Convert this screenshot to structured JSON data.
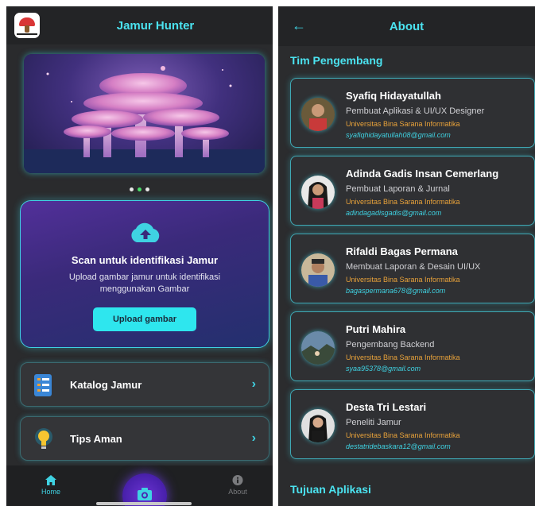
{
  "home": {
    "app_title": "Jamur Hunter",
    "logo_icon": "mushroom-logo-icon",
    "banner": {
      "image": "glowing-mushroom-illustration",
      "dots": 3,
      "active_dot": 2
    },
    "scan_card": {
      "icon": "cloud-upload-icon",
      "title": "Scan untuk identifikasi Jamur",
      "description": "Upload gambar jamur untuk identifikasi menggunakan Gambar",
      "button_label": "Upload gambar"
    },
    "menu": [
      {
        "label": "Katalog Jamur",
        "icon": "catalog-icon"
      },
      {
        "label": "Tips Aman",
        "icon": "lightbulb-icon"
      }
    ],
    "bottom_nav": {
      "home_label": "Home",
      "about_label": "About",
      "camera_icon": "camera-icon"
    }
  },
  "about": {
    "title": "About",
    "back_icon": "arrow-left-icon",
    "team_title": "Tim Pengembang",
    "purpose_title": "Tujuan Aplikasi",
    "developers": [
      {
        "name": "Syafiq Hidayatullah",
        "role": "Pembuat Aplikasi & UI/UX Designer",
        "university": "Universitas Bina Sarana Informatika",
        "email": "syafiqhidayatullah08@gmail.com"
      },
      {
        "name": "Adinda Gadis Insan Cemerlang",
        "role": "Pembuat Laporan & Jurnal",
        "university": "Universitas Bina Sarana Informatika",
        "email": "adindagadisgadis@gmail.com"
      },
      {
        "name": "Rifaldi Bagas Permana",
        "role": "Membuat Laporan & Desain UI/UX",
        "university": "Universitas Bina Sarana Informatika",
        "email": "bagaspermana678@gmail.com"
      },
      {
        "name": "Putri Mahira",
        "role": "Pengembang Backend",
        "university": "Universitas Bina Sarana Informatika",
        "email": "syaa95378@gmail.com"
      },
      {
        "name": "Desta Tri Lestari",
        "role": "Peneliti Jamur",
        "university": "Universitas Bina Sarana Informatika",
        "email": "destatridebaskara12@gmail.com"
      }
    ]
  },
  "colors": {
    "accent": "#3fd2e2",
    "univ_text": "#e8a23a",
    "background": "#2a2b2d",
    "scan_card": "#4a2f92"
  }
}
